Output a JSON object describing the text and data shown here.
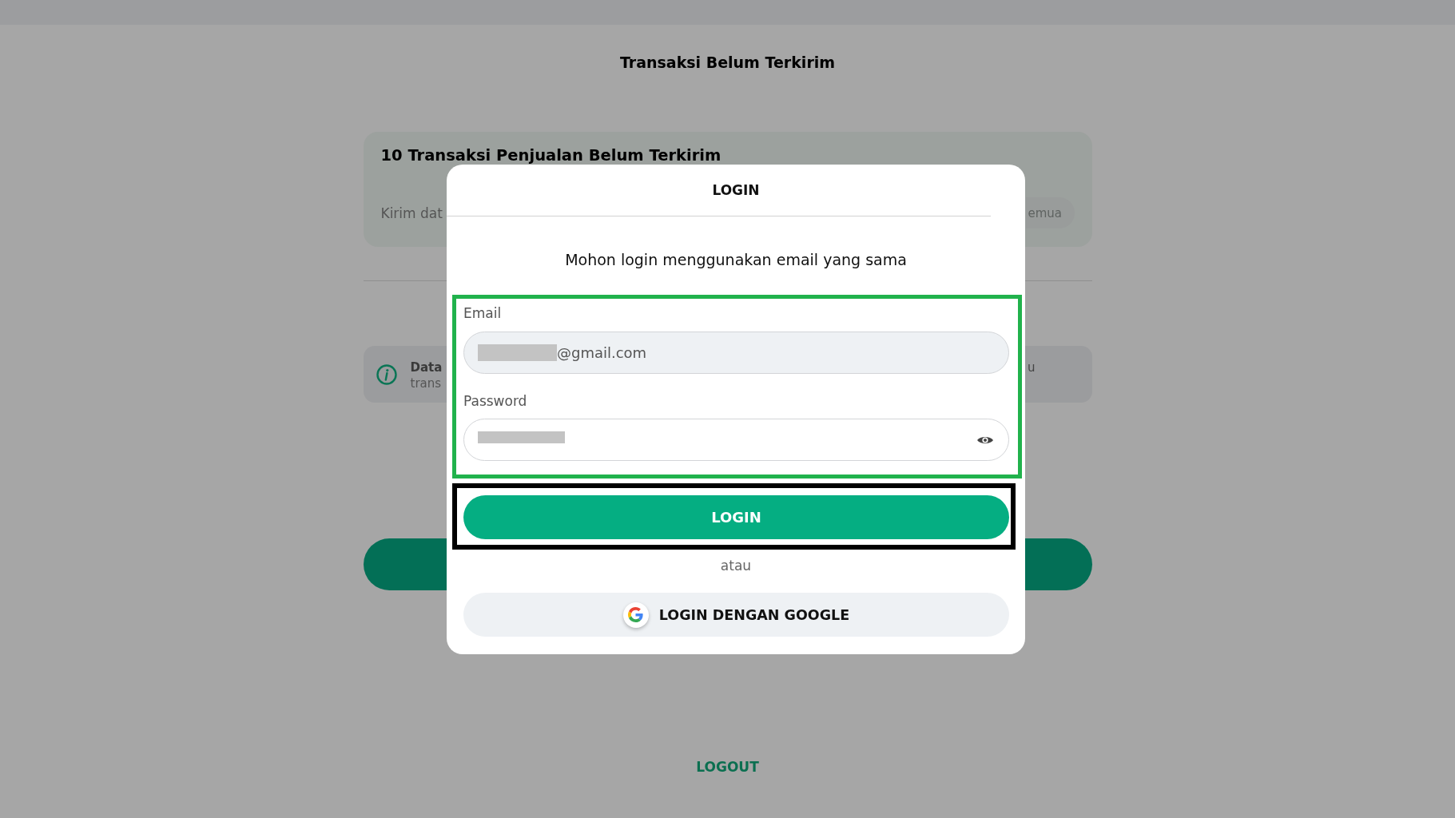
{
  "page": {
    "title": "Transaksi Belum Terkirim"
  },
  "pending_card": {
    "title": "10 Transaksi Penjualan Belum Terkirim",
    "description": "Kirim dat",
    "button": "emua"
  },
  "info_banner": {
    "title": "Data",
    "text": "trans",
    "text_right": "u"
  },
  "logout": "LOGOUT",
  "login_dialog": {
    "title": "LOGIN",
    "message": "Mohon login menggunakan email yang sama",
    "fields": [
      {
        "kind": "email",
        "label": "Email",
        "value": "@gmail.com",
        "redacted": true
      },
      {
        "kind": "password",
        "label": "Password",
        "redacted": true
      }
    ],
    "login_button": "LOGIN",
    "separator": "atau",
    "google_button": "LOGIN DENGAN GOOGLE"
  }
}
